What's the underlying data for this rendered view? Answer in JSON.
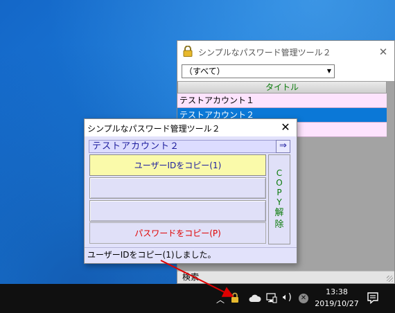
{
  "main_window": {
    "title": "シンプルなパスワード管理ツール２",
    "close_symbol": "✕",
    "filter": {
      "selected": "（すべて）"
    },
    "grid": {
      "header": "タイトル",
      "rows": [
        "テストアカウント１",
        "テストアカウント２"
      ]
    },
    "status": "検索"
  },
  "popup": {
    "title": "シンプルなパスワード管理ツール２",
    "close_symbol": "✕",
    "account": "テストアカウント２",
    "next_label": "⇒",
    "copy_user_id_label": "ユーザーIDをコピー(1)",
    "empty_button_1": "",
    "empty_button_2": "",
    "copy_password_label": "パスワードをコピー(P)",
    "copy_release_chars": [
      "C",
      "O",
      "P",
      "Y",
      "解",
      "除"
    ],
    "status": "ユーザーIDをコピー(1)しました。"
  },
  "taskbar": {
    "time": "13:38",
    "date": "2019/10/27"
  },
  "colors": {
    "desktop": "#1a74d4",
    "popup_bg": "#e2e2fb",
    "copy_uid_bg": "#fafaaa",
    "selected_row": "#0b78d7",
    "pink_row": "#fde3fd",
    "arrow": "#e00000"
  },
  "icons": {
    "app_lock": "lock-icon",
    "tray": [
      "chevron-up-icon",
      "lock-icon",
      "cloud-icon",
      "network-icon",
      "volume-icon",
      "close-circle-icon",
      "notification-icon"
    ]
  }
}
